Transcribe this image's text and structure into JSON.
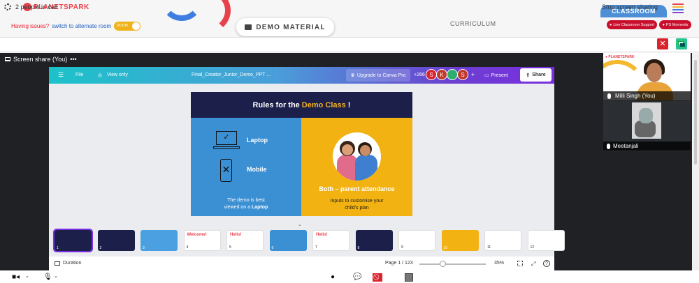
{
  "header": {
    "logo": "PLANETSPARK",
    "issues_text": "Having issues?",
    "switch_link": "switch to alternate room",
    "room_toggle": "ROOM",
    "demo_material": "DEMO MATERIAL",
    "curriculum": "CURRICULUM",
    "classroom_tab": "CLASSROOM",
    "live_support": "Live Classroom Support",
    "ps_moments": "PS Moments"
  },
  "call": {
    "people_in_call": "2 people in call",
    "stop_sharing": "Stop screen sharing",
    "screen_share_label": "Screen share (You)"
  },
  "canva": {
    "menu": "File",
    "view_only": "View only",
    "doc_title": "Final_Creator_Junior_Demo_PPT ...",
    "upgrade": "Upgrade to Canva Pro",
    "collab_count": "+266",
    "avatars": [
      {
        "letter": "S",
        "color": "#d9232e"
      },
      {
        "letter": "K",
        "color": "#c0392b"
      },
      {
        "letter": "",
        "color": "#2eae6f"
      },
      {
        "letter": "S",
        "color": "#c0392b"
      }
    ],
    "plus": "+",
    "present": "Present",
    "share": "Share"
  },
  "slide": {
    "title_prefix": "Rules for the",
    "title_highlight": "Demo Class",
    "title_suffix": "!",
    "laptop_label": "Laptop",
    "mobile_label": "Mobile",
    "demo_best_line1": "The demo is best",
    "demo_best_line2": "viewed on a",
    "demo_best_bold": "Laptop",
    "both_label": "Both – parent attendance",
    "inputs_line1": "Inputs to customise your",
    "inputs_line2": "child's plan"
  },
  "filmstrip": {
    "thumbnails": [
      {
        "n": "1",
        "title": "",
        "bg": "#1b1f4a"
      },
      {
        "n": "2",
        "title": "",
        "bg": "#1b1f4a"
      },
      {
        "n": "3",
        "title": "",
        "bg": "#4aa0e0"
      },
      {
        "n": "4",
        "title": "Welcome!",
        "bg": "#ffffff"
      },
      {
        "n": "5",
        "title": "Hello!",
        "bg": "#ffffff"
      },
      {
        "n": "6",
        "title": "",
        "bg": "#3b8fd3"
      },
      {
        "n": "7",
        "title": "Hello!",
        "bg": "#ffffff"
      },
      {
        "n": "8",
        "title": "",
        "bg": "#1b1f4a"
      },
      {
        "n": "9",
        "title": "",
        "bg": "#ffffff"
      },
      {
        "n": "10",
        "title": "",
        "bg": "#f2b212"
      },
      {
        "n": "11",
        "title": "",
        "bg": "#ffffff"
      },
      {
        "n": "12",
        "title": "",
        "bg": "#ffffff"
      }
    ]
  },
  "status": {
    "duration": "Duration",
    "page": "Page 1 / 123",
    "zoom": "35%",
    "zoom_level": 0.35,
    "help": "?"
  },
  "participants": [
    {
      "name": "Milli Singh (You)"
    },
    {
      "name": "Meetanjali"
    }
  ],
  "colors": {
    "brand_red": "#e9414b",
    "canva_teal": "#1cc2c9",
    "canva_purple": "#7a2ee0",
    "slide_blue": "#3b8fd3",
    "slide_yellow": "#f2b212",
    "slide_navy": "#1b1f4a",
    "classroom_blue": "#4d8fd6",
    "stop_red": "#d9232e",
    "share_green": "#27c38b"
  }
}
